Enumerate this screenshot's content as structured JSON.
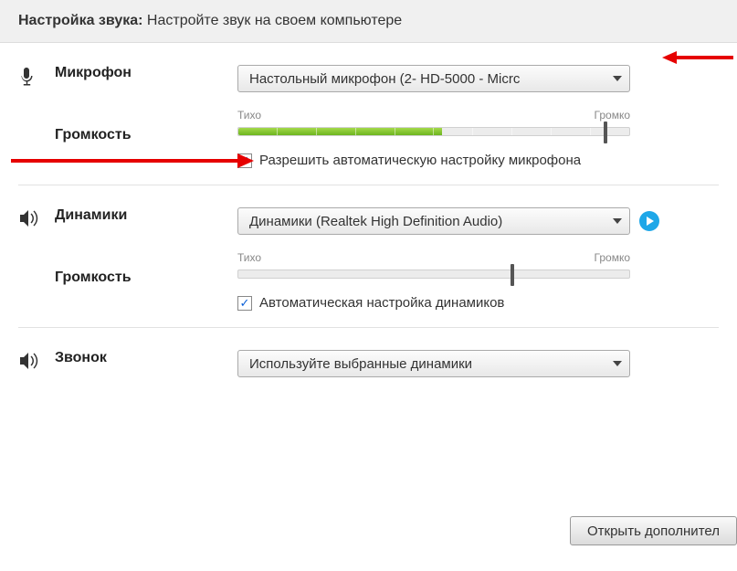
{
  "header": {
    "title_bold": "Настройка звука:",
    "title_rest": "Настройте звук на своем компьютере"
  },
  "mic": {
    "label": "Микрофон",
    "dropdown": "Настольный микрофон (2- HD-5000 - Micrc",
    "volume_label": "Громкость",
    "slider_low": "Тихо",
    "slider_high": "Громко",
    "slider_fill_pct": 52,
    "slider_thumb_pct": 94,
    "checkbox_checked": true,
    "checkbox_label": "Разрешить автоматическую настройку микрофона"
  },
  "speakers": {
    "label": "Динамики",
    "dropdown": "Динамики (Realtek High Definition Audio)",
    "volume_label": "Громкость",
    "slider_low": "Тихо",
    "slider_high": "Громко",
    "slider_fill_pct": 0,
    "slider_thumb_pct": 70,
    "checkbox_checked": true,
    "checkbox_label": "Автоматическая настройка динамиков"
  },
  "ring": {
    "label": "Звонок",
    "dropdown": "Используйте выбранные динамики"
  },
  "footer": {
    "button": "Открыть дополнител"
  }
}
